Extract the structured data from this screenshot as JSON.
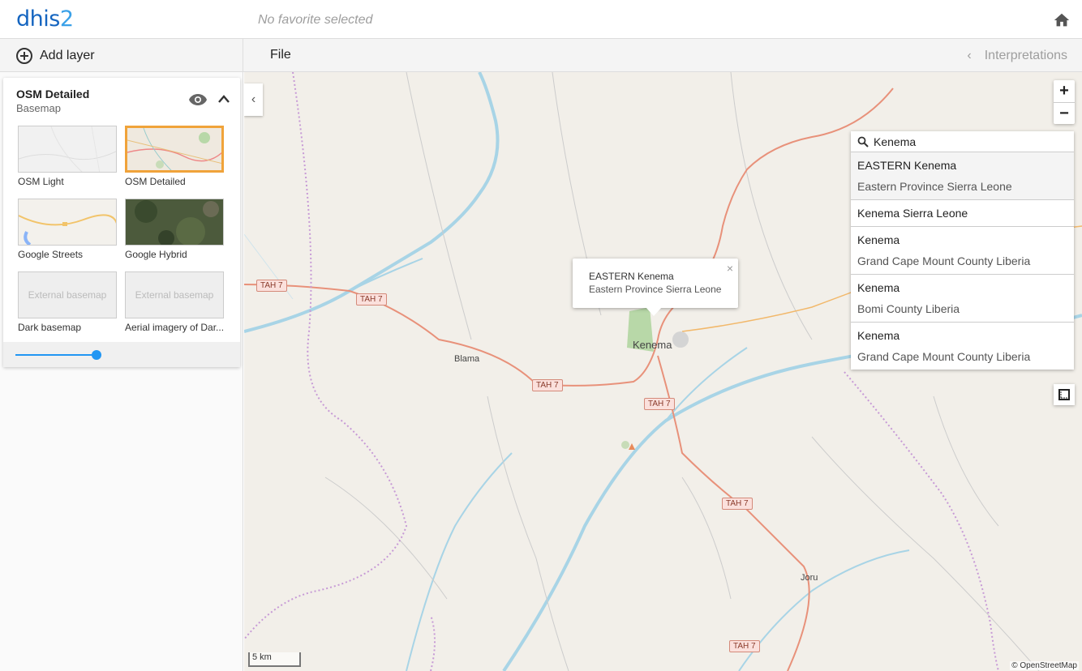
{
  "header": {
    "logo_main": "dhis",
    "logo_accent": "2",
    "favorite": "No favorite selected"
  },
  "toolbar": {
    "add_layer": "Add layer",
    "file": "File",
    "interpretations": "Interpretations"
  },
  "layer_card": {
    "title": "OSM Detailed",
    "subtitle": "Basemap",
    "basemaps": [
      {
        "label": "OSM Light",
        "selected": false
      },
      {
        "label": "OSM Detailed",
        "selected": true
      },
      {
        "label": "Google Streets",
        "selected": false
      },
      {
        "label": "Google Hybrid",
        "selected": false
      },
      {
        "label": "Dark basemap",
        "thumb_text": "External basemap",
        "selected": false
      },
      {
        "label": "Aerial imagery of Dar...",
        "thumb_text": "External basemap",
        "selected": false
      }
    ],
    "opacity": 1.0
  },
  "search": {
    "value": "Kenema",
    "results": [
      {
        "name": "EASTERN Kenema",
        "detail": "Eastern Province Sierra Leone"
      },
      {
        "name": "Kenema Sierra Leone",
        "detail": ""
      },
      {
        "name": "Kenema",
        "detail": "Grand Cape Mount County Liberia"
      },
      {
        "name": "Kenema",
        "detail": "Bomi County Liberia"
      },
      {
        "name": "Kenema",
        "detail": "Grand Cape Mount County Liberia"
      }
    ]
  },
  "popup": {
    "line1": "EASTERN Kenema",
    "line2": "Eastern Province Sierra Leone",
    "close": "×"
  },
  "map": {
    "labels": {
      "kenema": "Kenema",
      "blama": "Blama",
      "joru": "Joru"
    },
    "road": "TAH 7",
    "scale": "5 km",
    "attribution": "© OpenStreetMap"
  },
  "colors": {
    "accent": "#2196f3",
    "selected_border": "#f0a33a",
    "river": "#a8d4e6",
    "road": "#e8917a",
    "border": "#c79ad6"
  }
}
